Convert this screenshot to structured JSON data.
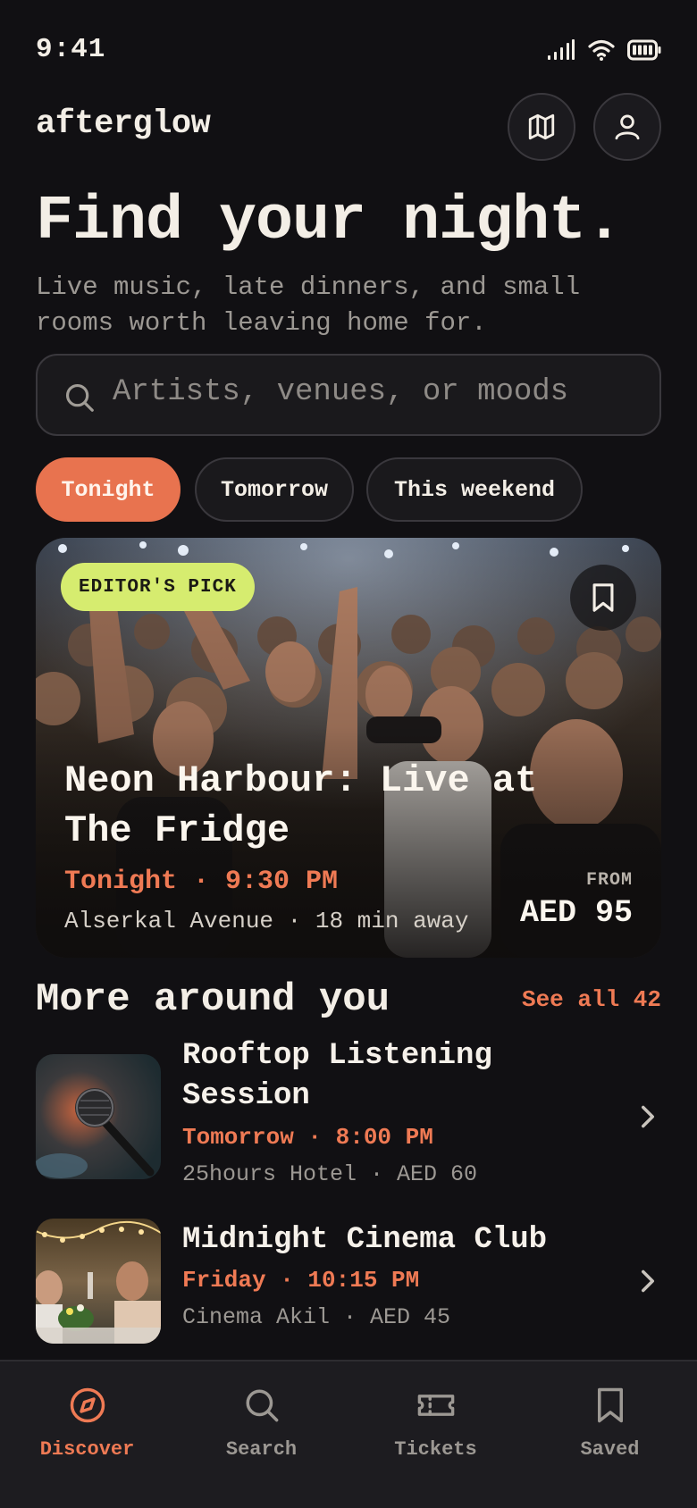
{
  "status": {
    "time": "9:41"
  },
  "app": {
    "brand": "afterglow"
  },
  "hero": {
    "title": "Find your night.",
    "subtitle_line1": "Live music, late dinners, and small",
    "subtitle_line2": "rooms worth leaving home for."
  },
  "search": {
    "placeholder": "Artists, venues, or moods"
  },
  "filters": [
    {
      "label": "Tonight",
      "active": true
    },
    {
      "label": "Tomorrow",
      "active": false
    },
    {
      "label": "This weekend",
      "active": false
    }
  ],
  "featured": {
    "badge": "EDITOR'S PICK",
    "title_line1": "Neon Harbour: Live at",
    "title_line2": "The Fridge",
    "when": "Tonight · 9:30 PM",
    "where": "Alserkal Avenue · 18 min away",
    "price_label": "FROM",
    "price": "AED 95"
  },
  "section": {
    "title": "More around you",
    "see_all": "See all 42"
  },
  "events": [
    {
      "title_line1": "Rooftop Listening",
      "title_line2": "Session",
      "when": "Tomorrow · 8:00 PM",
      "meta": "25hours Hotel · AED 60",
      "thumb_icon": "microphone-photo"
    },
    {
      "title_line1": "Midnight Cinema Club",
      "when": "Friday · 10:15 PM",
      "meta": "Cinema Akil · AED 45",
      "thumb_icon": "dinner-party-photo"
    }
  ],
  "tabs": [
    {
      "label": "Discover",
      "icon": "compass-icon",
      "active": true
    },
    {
      "label": "Search",
      "icon": "search-icon",
      "active": false
    },
    {
      "label": "Tickets",
      "icon": "ticket-icon",
      "active": false
    },
    {
      "label": "Saved",
      "icon": "bookmark-icon",
      "active": false
    }
  ],
  "colors": {
    "background": "#111013",
    "accent": "#e8734f",
    "badge": "#d6ec6f",
    "muted": "#9c9893"
  }
}
